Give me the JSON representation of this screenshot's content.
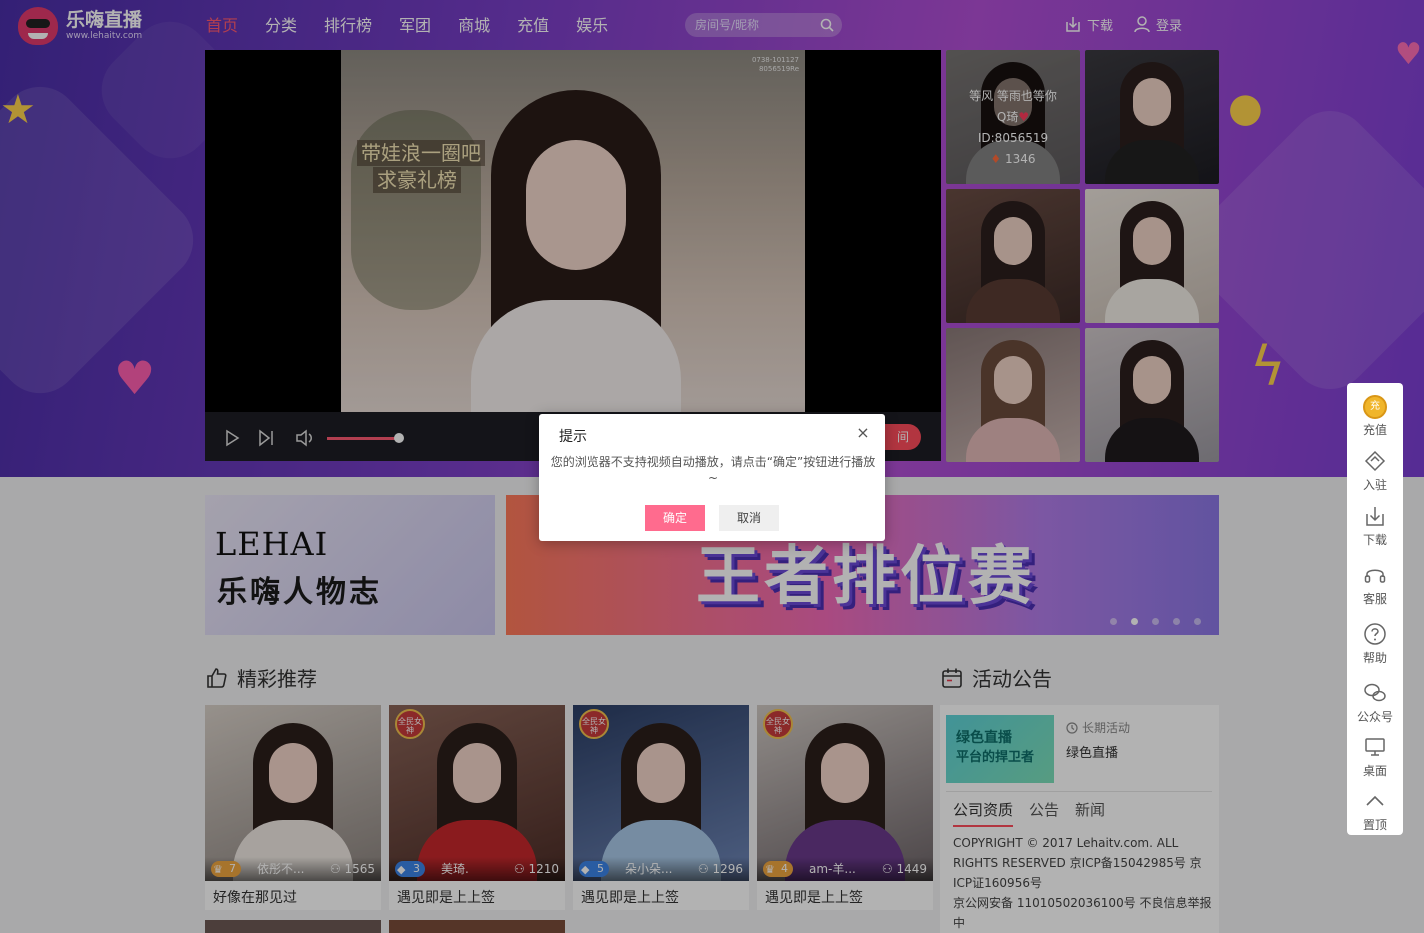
{
  "header": {
    "logo_name": "乐嗨直播",
    "logo_url": "www.lehaitv.com",
    "nav": [
      "首页",
      "分类",
      "排行榜",
      "军团",
      "商城",
      "充值",
      "娱乐"
    ],
    "search_placeholder": "房间号/昵称",
    "download_label": "下载",
    "login_label": "登录",
    "accent_color": "#ff5a72"
  },
  "player": {
    "caption_1": "带娃浪一圈吧",
    "caption_2": "求豪礼榜",
    "watermark_1": "0738-101127",
    "watermark_2": "8056519Re",
    "enter_label": "间",
    "volume_level": 0.9
  },
  "thumbs": {
    "featured": {
      "title": "等风 等雨也等你",
      "name": "Q琦",
      "id_text": "ID:8056519",
      "viewers": "1346"
    }
  },
  "banners": {
    "left_en": "LEHAI",
    "left_cn": "乐嗨人物志",
    "right_title": "王者排位赛",
    "active_dot": 1
  },
  "recommend": {
    "title": "精彩推荐",
    "cards": [
      {
        "level": "7",
        "nick": "依彤不...",
        "viewers": "1565",
        "desc": "好像在那见过"
      },
      {
        "level": "3",
        "nick": "美琦.",
        "viewers": "1210",
        "desc": "遇见即是上上签"
      },
      {
        "level": "5",
        "nick": "朵小朵...",
        "viewers": "1296",
        "desc": "遇见即是上上签"
      },
      {
        "level": "4",
        "nick": "am-羊...",
        "viewers": "1449",
        "desc": "遇见即是上上签"
      }
    ],
    "badge_text": "全民女神"
  },
  "announce": {
    "title": "活动公告",
    "img_line1": "绿色直播",
    "img_line2": "平台的捍卫者",
    "tag": "长期活动",
    "name": "绿色直播",
    "tabs": [
      "公司资质",
      "公告",
      "新闻"
    ],
    "copyright": "COPYRIGHT © 2017 Lehaitv.com. ALL RIGHTS RESERVED 京ICP备15042985号 京ICP证160956号",
    "police": "京公网安备 11010502036100号 不良信息举报中"
  },
  "sidebar": {
    "coin_char": "充",
    "items": [
      "充值",
      "入驻",
      "下载",
      "客服",
      "帮助",
      "公众号",
      "桌面",
      "置顶"
    ]
  },
  "dialog": {
    "title": "提示",
    "close": "×",
    "message": "您的浏览器不支持视频自动播放，请点击“确定”按钮进行播放~",
    "ok": "确定",
    "cancel": "取消"
  }
}
